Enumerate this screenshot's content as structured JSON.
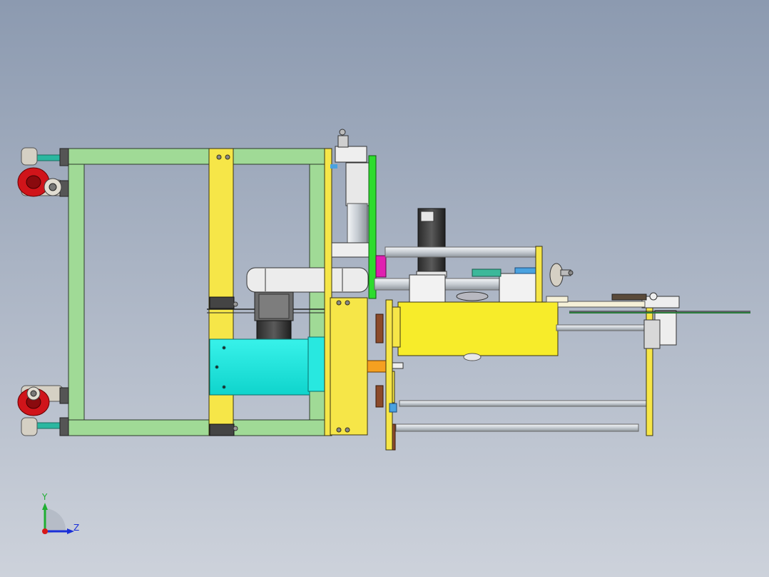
{
  "axis_triad": {
    "y_label": "Y",
    "z_label": "Z"
  },
  "colors": {
    "background_top": "#8e9cb1",
    "background_bottom": "#c9ced8",
    "frame_green": "#a0da96",
    "frame_yellow": "#f6e648",
    "motor_cyan": "#1de8e0",
    "caster_red": "#d0141a",
    "gearbox_dark": "#4a4a4a",
    "plate_bright_green": "#2edc2e",
    "accent_magenta": "#e020b0",
    "accent_orange": "#f5a020",
    "spring_brown": "#8b4a2a",
    "axis_y": "#1fae32",
    "axis_z": "#1a2fd8",
    "axis_x": "#d81818"
  }
}
